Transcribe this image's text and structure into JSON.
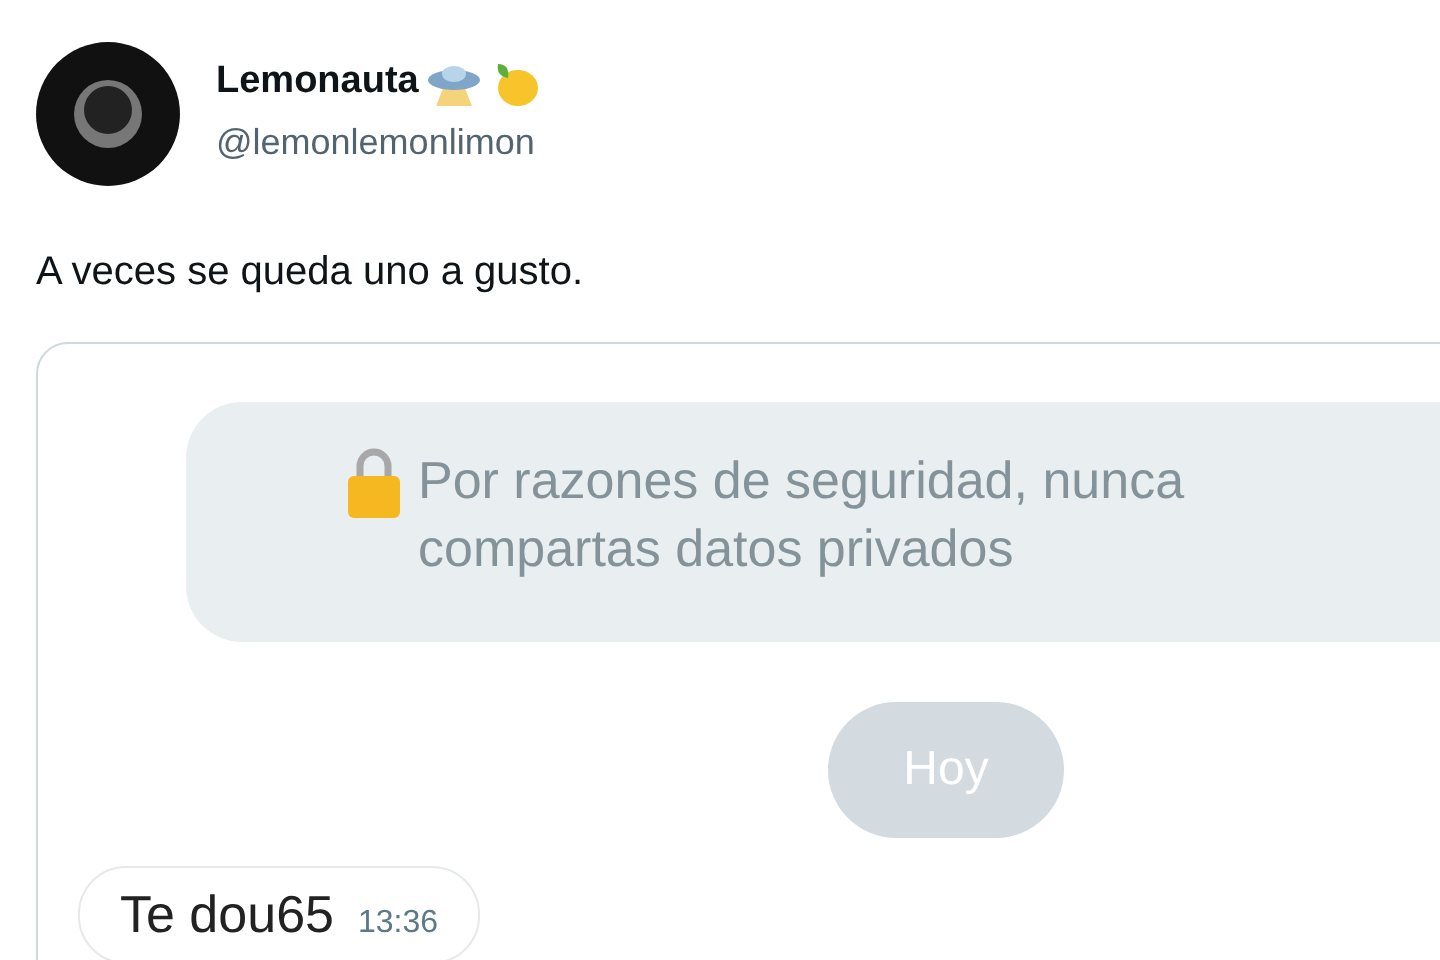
{
  "author": {
    "name": "Lemonauta",
    "handle": "@lemonlemonlimon"
  },
  "tweet": {
    "text": "A veces se queda uno a gusto."
  },
  "chat": {
    "notice": {
      "lines": [
        "Por razones de seguridad, nunca",
        "compartas datos privados"
      ]
    },
    "date_divider": "Hoy",
    "messages": [
      {
        "text": "Te dou65",
        "time": "13:36"
      }
    ]
  }
}
